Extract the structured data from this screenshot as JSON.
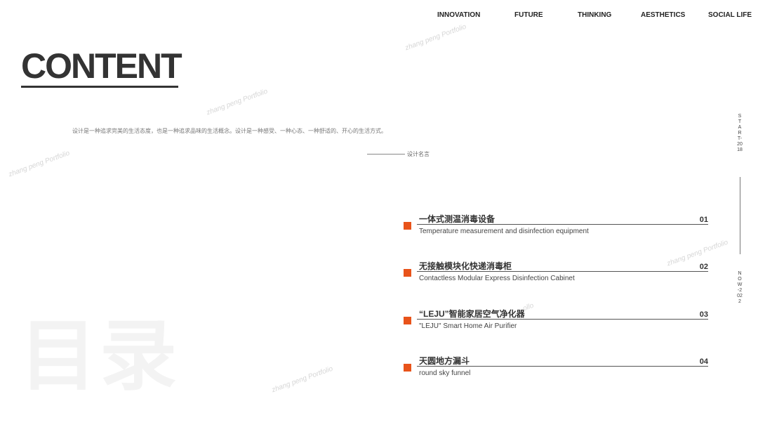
{
  "nav": {
    "items": [
      "INNOVATION",
      "FUTURE",
      "THINKING",
      "AESTHETICS",
      "SOCIAL LIFE"
    ]
  },
  "title": "CONTENT",
  "intro": "设计是一种追求完美的生活态度，也是一种追求品味的生活概念。设计是一种感受、一种心态、一种舒适的、开心的生活方式。",
  "quote_label": "设计名言",
  "watermark": "zhang peng Portfolio",
  "watermark_partial": "ollo",
  "big_chinese": "目录",
  "side": {
    "start": "START-2018",
    "now": "NOW-2022"
  },
  "items": [
    {
      "cn": "一体式测温消毒设备",
      "en": "Temperature measurement and disinfection equipment",
      "num": "01"
    },
    {
      "cn": "无接触模块化快递消毒柜",
      "en": "Contactless Modular Express Disinfection Cabinet",
      "num": "02"
    },
    {
      "cn": "“LEJU”智能家居空气净化器",
      "en": "\"LEJU\" Smart Home Air Purifier",
      "num": "03"
    },
    {
      "cn": "天圆地方漏斗",
      "en": "round sky funnel",
      "num": "04"
    }
  ],
  "colors": {
    "accent": "#e8531a",
    "text": "#333333"
  }
}
